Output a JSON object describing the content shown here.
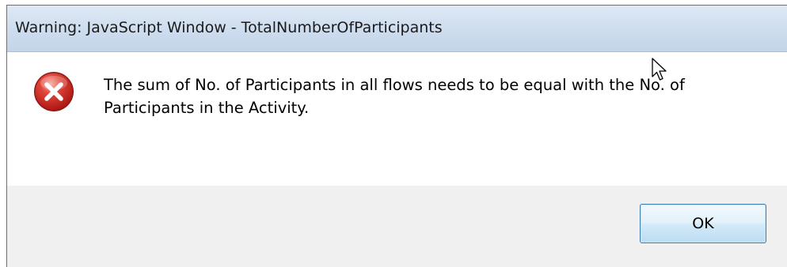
{
  "dialog": {
    "title": "Warning: JavaScript Window - TotalNumberOfParticipants",
    "message": "The sum of No. of Participants in all flows needs to be equal with the No. of Participants in the Activity.",
    "icon": "error-icon",
    "ok_label": "OK"
  },
  "colors": {
    "titlebar": "#cddcee",
    "content_bg": "#ffffff",
    "button_area_bg": "#f0f0f0",
    "error_red": "#d9282b",
    "button_border": "#3c7fb1"
  }
}
